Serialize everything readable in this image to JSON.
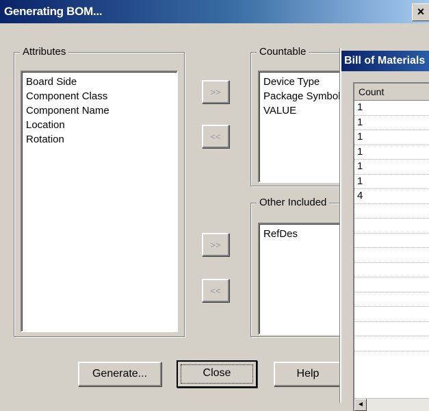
{
  "window": {
    "title": "Generating BOM...",
    "close_glyph": "×"
  },
  "attributes": {
    "label": "Attributes",
    "items": [
      "Board Side",
      "Component Class",
      "Component Name",
      "Location",
      "Rotation"
    ]
  },
  "countable": {
    "label": "Countable",
    "items": [
      "Device Type",
      "Package Symbol",
      "VALUE"
    ]
  },
  "other_included": {
    "label": "Other Included",
    "items": [
      "RefDes"
    ]
  },
  "arrows": {
    "add": ">>",
    "remove": "<<"
  },
  "buttons": {
    "generate": "Generate...",
    "close": "Close",
    "help": "Help"
  },
  "bom_window": {
    "title": "Bill of Materials",
    "column_header": "Count",
    "counts": [
      "1",
      "1",
      "1",
      "1",
      "1",
      "1",
      "4"
    ],
    "scroll_left_glyph": "◄"
  }
}
